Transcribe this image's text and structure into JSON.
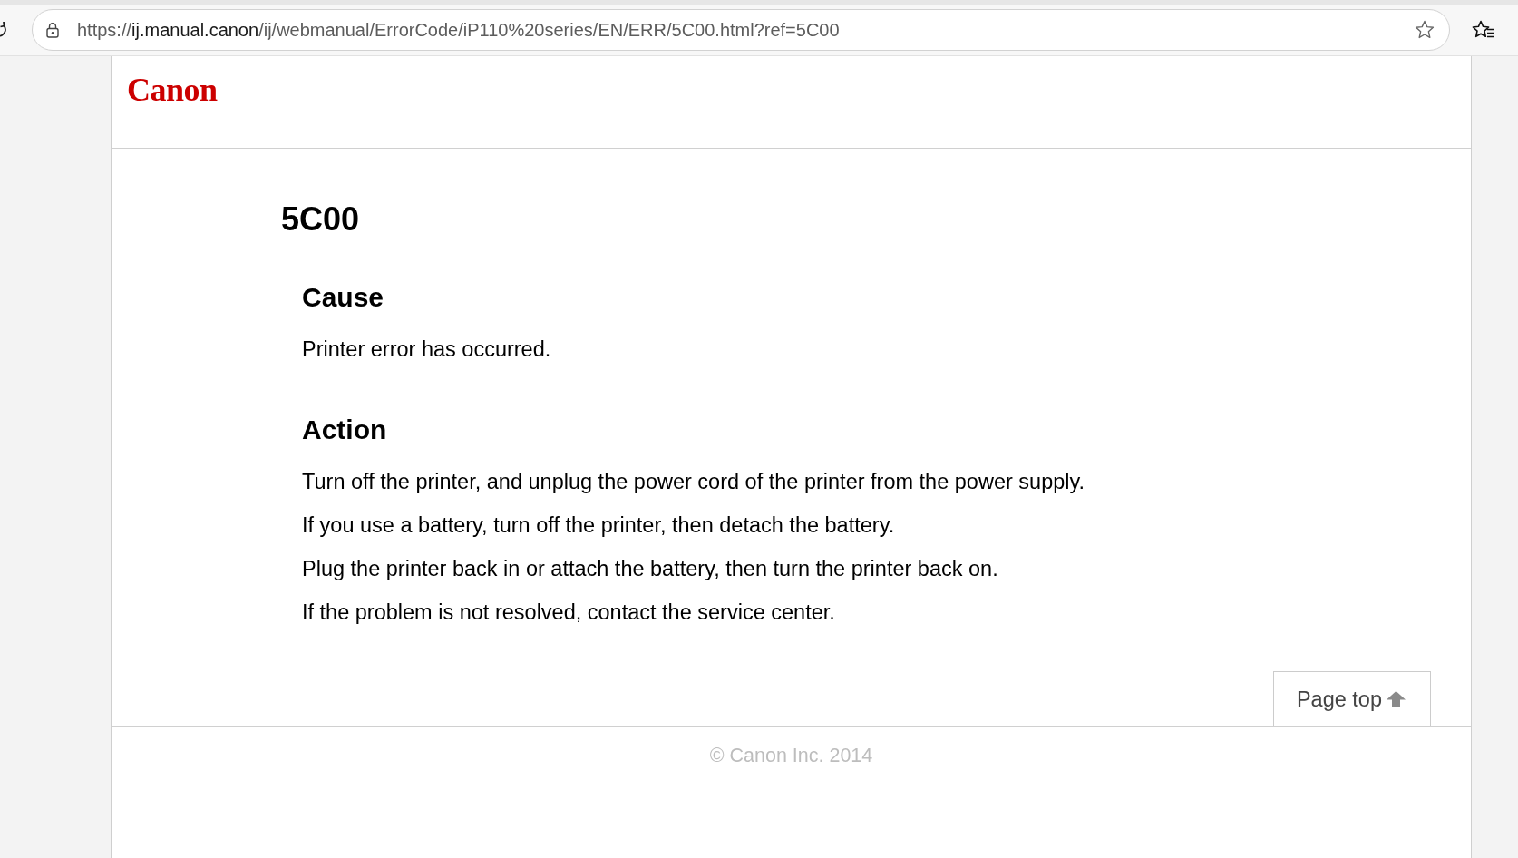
{
  "browser": {
    "address_bar": {
      "scheme": "https://",
      "host": "ij.manual.canon",
      "path": "/ij/webmanual/ErrorCode/iP110%20series/EN/ERR/5C00.html?ref=5C00"
    }
  },
  "header": {
    "logo": "Canon"
  },
  "article": {
    "title": "5C00",
    "sections": [
      {
        "heading": "Cause",
        "paragraphs": [
          "Printer error has occurred."
        ]
      },
      {
        "heading": "Action",
        "paragraphs": [
          "Turn off the printer, and unplug the power cord of the printer from the power supply.",
          "If you use a battery, turn off the printer, then detach the battery.",
          "Plug the printer back in or attach the battery, then turn the printer back on.",
          "If the problem is not resolved, contact the service center."
        ]
      }
    ]
  },
  "page_top_button": {
    "label": "Page top"
  },
  "footer": {
    "copyright": "© Canon Inc. 2014"
  }
}
